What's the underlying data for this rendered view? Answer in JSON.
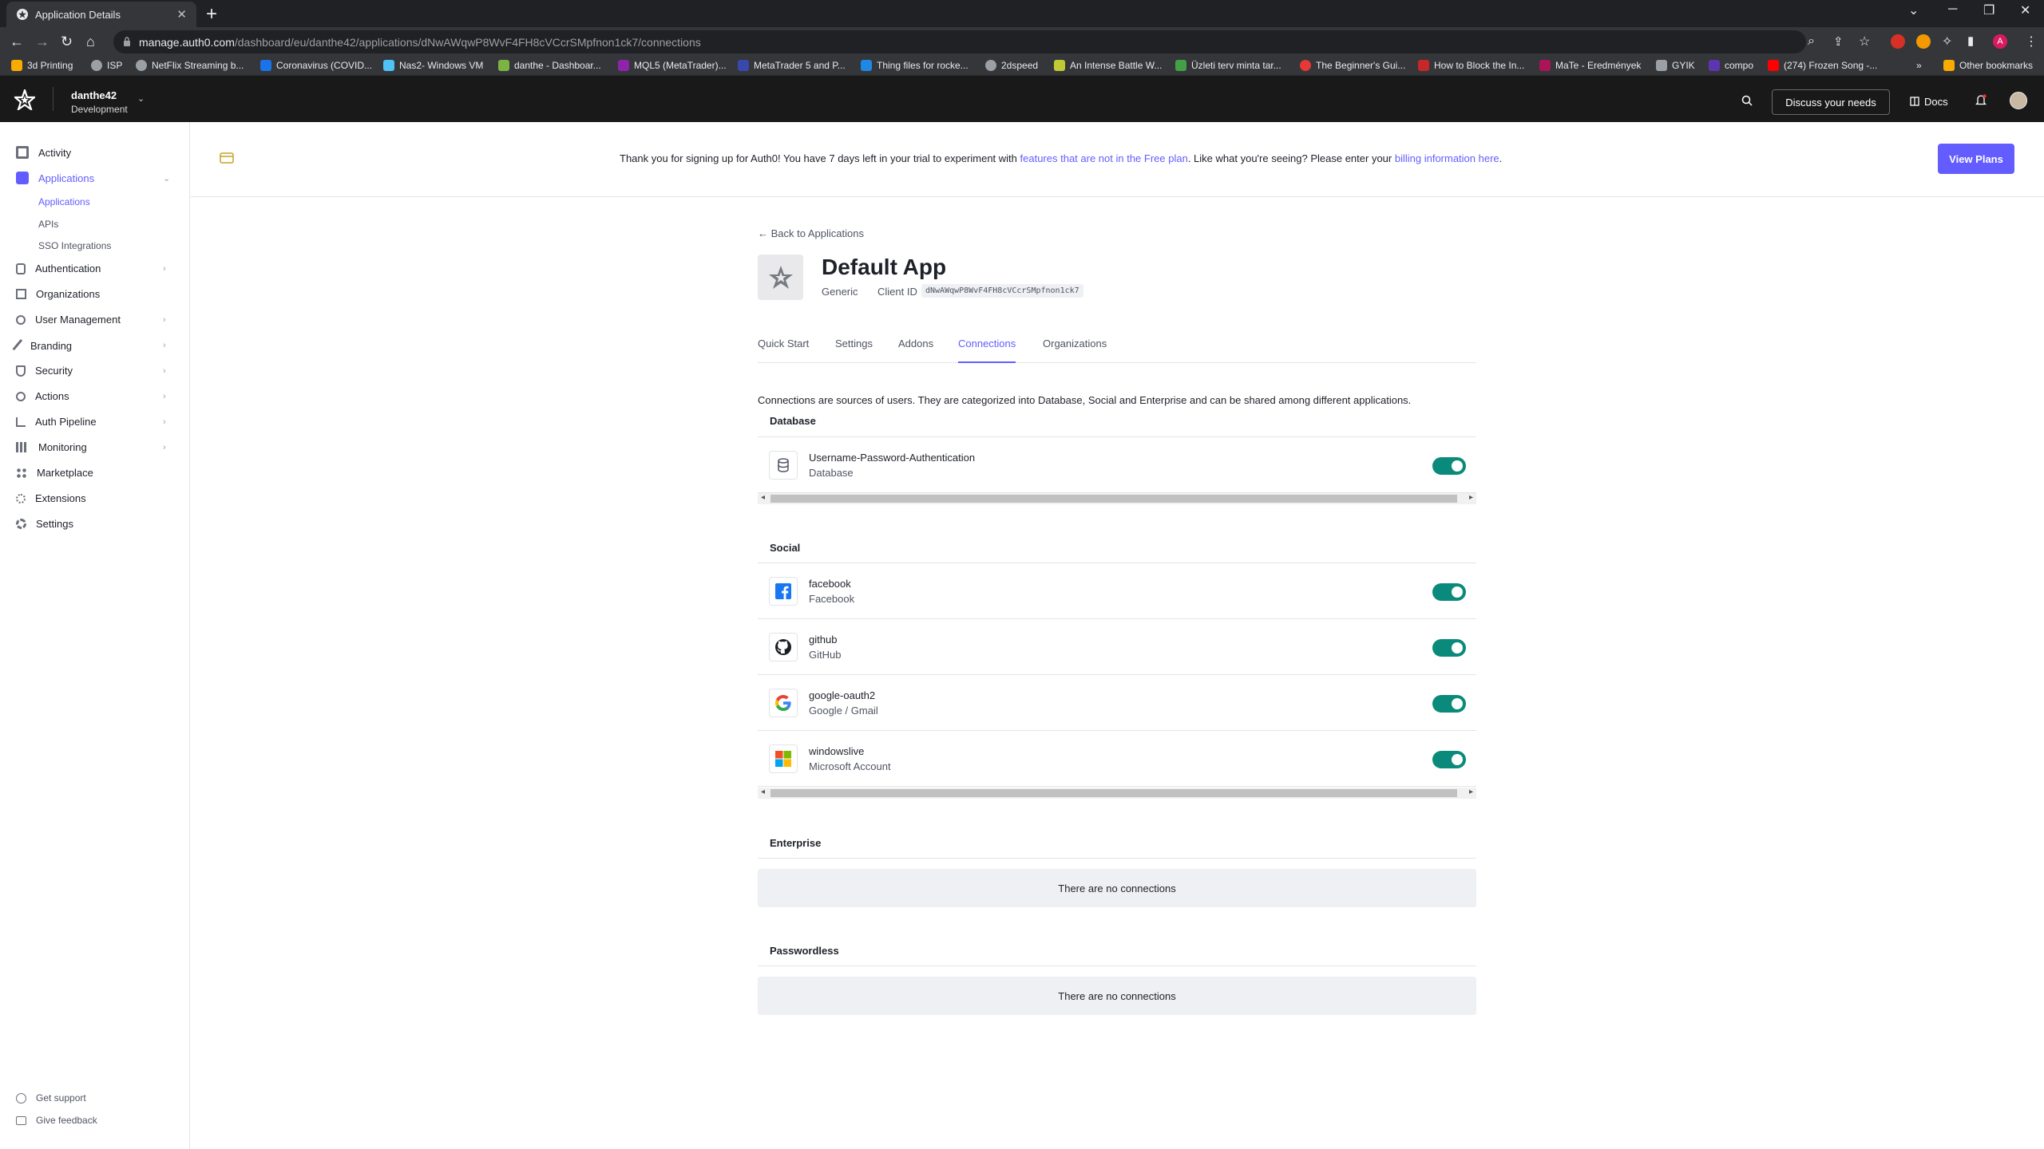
{
  "browser": {
    "tab_title": "Application Details",
    "url_host": "manage.auth0.com",
    "url_path": "/dashboard/eu/danthe42/applications/dNwAWqwP8WvF4FH8cVCcrSMpfnon1ck7/connections",
    "bookmarks": [
      "3d Printing",
      "ISP",
      "NetFlix Streaming b...",
      "Coronavirus (COVID...",
      "Nas2- Windows VM",
      "danthe - Dashboar...",
      "MQL5 (MetaTrader)...",
      "MetaTrader 5 and P...",
      "Thing files for rocke...",
      "2dspeed",
      "An Intense Battle W...",
      "Üzleti terv minta tar...",
      "The Beginner's Gui...",
      "How to Block the In...",
      "MaTe - Eredmények",
      "GYIK",
      "compo",
      "(274) Frozen Song -...",
      "»",
      "Other bookmarks"
    ],
    "profile_initial": "A"
  },
  "header": {
    "tenant_name": "danthe42",
    "tenant_env": "Development",
    "discuss_label": "Discuss your needs",
    "docs_label": "Docs"
  },
  "sidebar": {
    "items": [
      {
        "label": "Activity"
      },
      {
        "label": "Applications"
      },
      {
        "label": "Authentication"
      },
      {
        "label": "Organizations"
      },
      {
        "label": "User Management"
      },
      {
        "label": "Branding"
      },
      {
        "label": "Security"
      },
      {
        "label": "Actions"
      },
      {
        "label": "Auth Pipeline"
      },
      {
        "label": "Monitoring"
      },
      {
        "label": "Marketplace"
      },
      {
        "label": "Extensions"
      },
      {
        "label": "Settings"
      }
    ],
    "subitems": [
      "Applications",
      "APIs",
      "SSO Integrations"
    ],
    "footer": [
      "Get support",
      "Give feedback"
    ]
  },
  "banner": {
    "text_1": "Thank you for signing up for Auth0! You have 7 days left in your trial to experiment with ",
    "link_1": "features that are not in the Free plan",
    "text_2": ". Like what you're seeing? Please enter your ",
    "link_2": "billing information here",
    "text_3": ".",
    "button": "View Plans"
  },
  "app": {
    "back_label": "Back to Applications",
    "name": "Default App",
    "type": "Generic",
    "client_id_label": "Client ID",
    "client_id": "dNwAWqwP8WvF4FH8cVCcrSMpfnon1ck7",
    "tabs": [
      "Quick Start",
      "Settings",
      "Addons",
      "Connections",
      "Organizations"
    ],
    "active_tab": "Connections",
    "description": "Connections are sources of users. They are categorized into Database, Social and Enterprise and can be shared among different applications."
  },
  "sections": {
    "database": {
      "title": "Database",
      "rows": [
        {
          "name": "Username-Password-Authentication",
          "sub": "Database",
          "enabled": true
        }
      ]
    },
    "social": {
      "title": "Social",
      "rows": [
        {
          "name": "facebook",
          "sub": "Facebook",
          "enabled": true
        },
        {
          "name": "github",
          "sub": "GitHub",
          "enabled": true
        },
        {
          "name": "google-oauth2",
          "sub": "Google / Gmail",
          "enabled": true
        },
        {
          "name": "windowslive",
          "sub": "Microsoft Account",
          "enabled": true
        }
      ]
    },
    "enterprise": {
      "title": "Enterprise",
      "empty": "There are no connections"
    },
    "passwordless": {
      "title": "Passwordless",
      "empty": "There are no connections"
    }
  },
  "colors": {
    "accent": "#635dff",
    "toggle_on": "#0a8a7a",
    "header_bg": "#191919"
  }
}
